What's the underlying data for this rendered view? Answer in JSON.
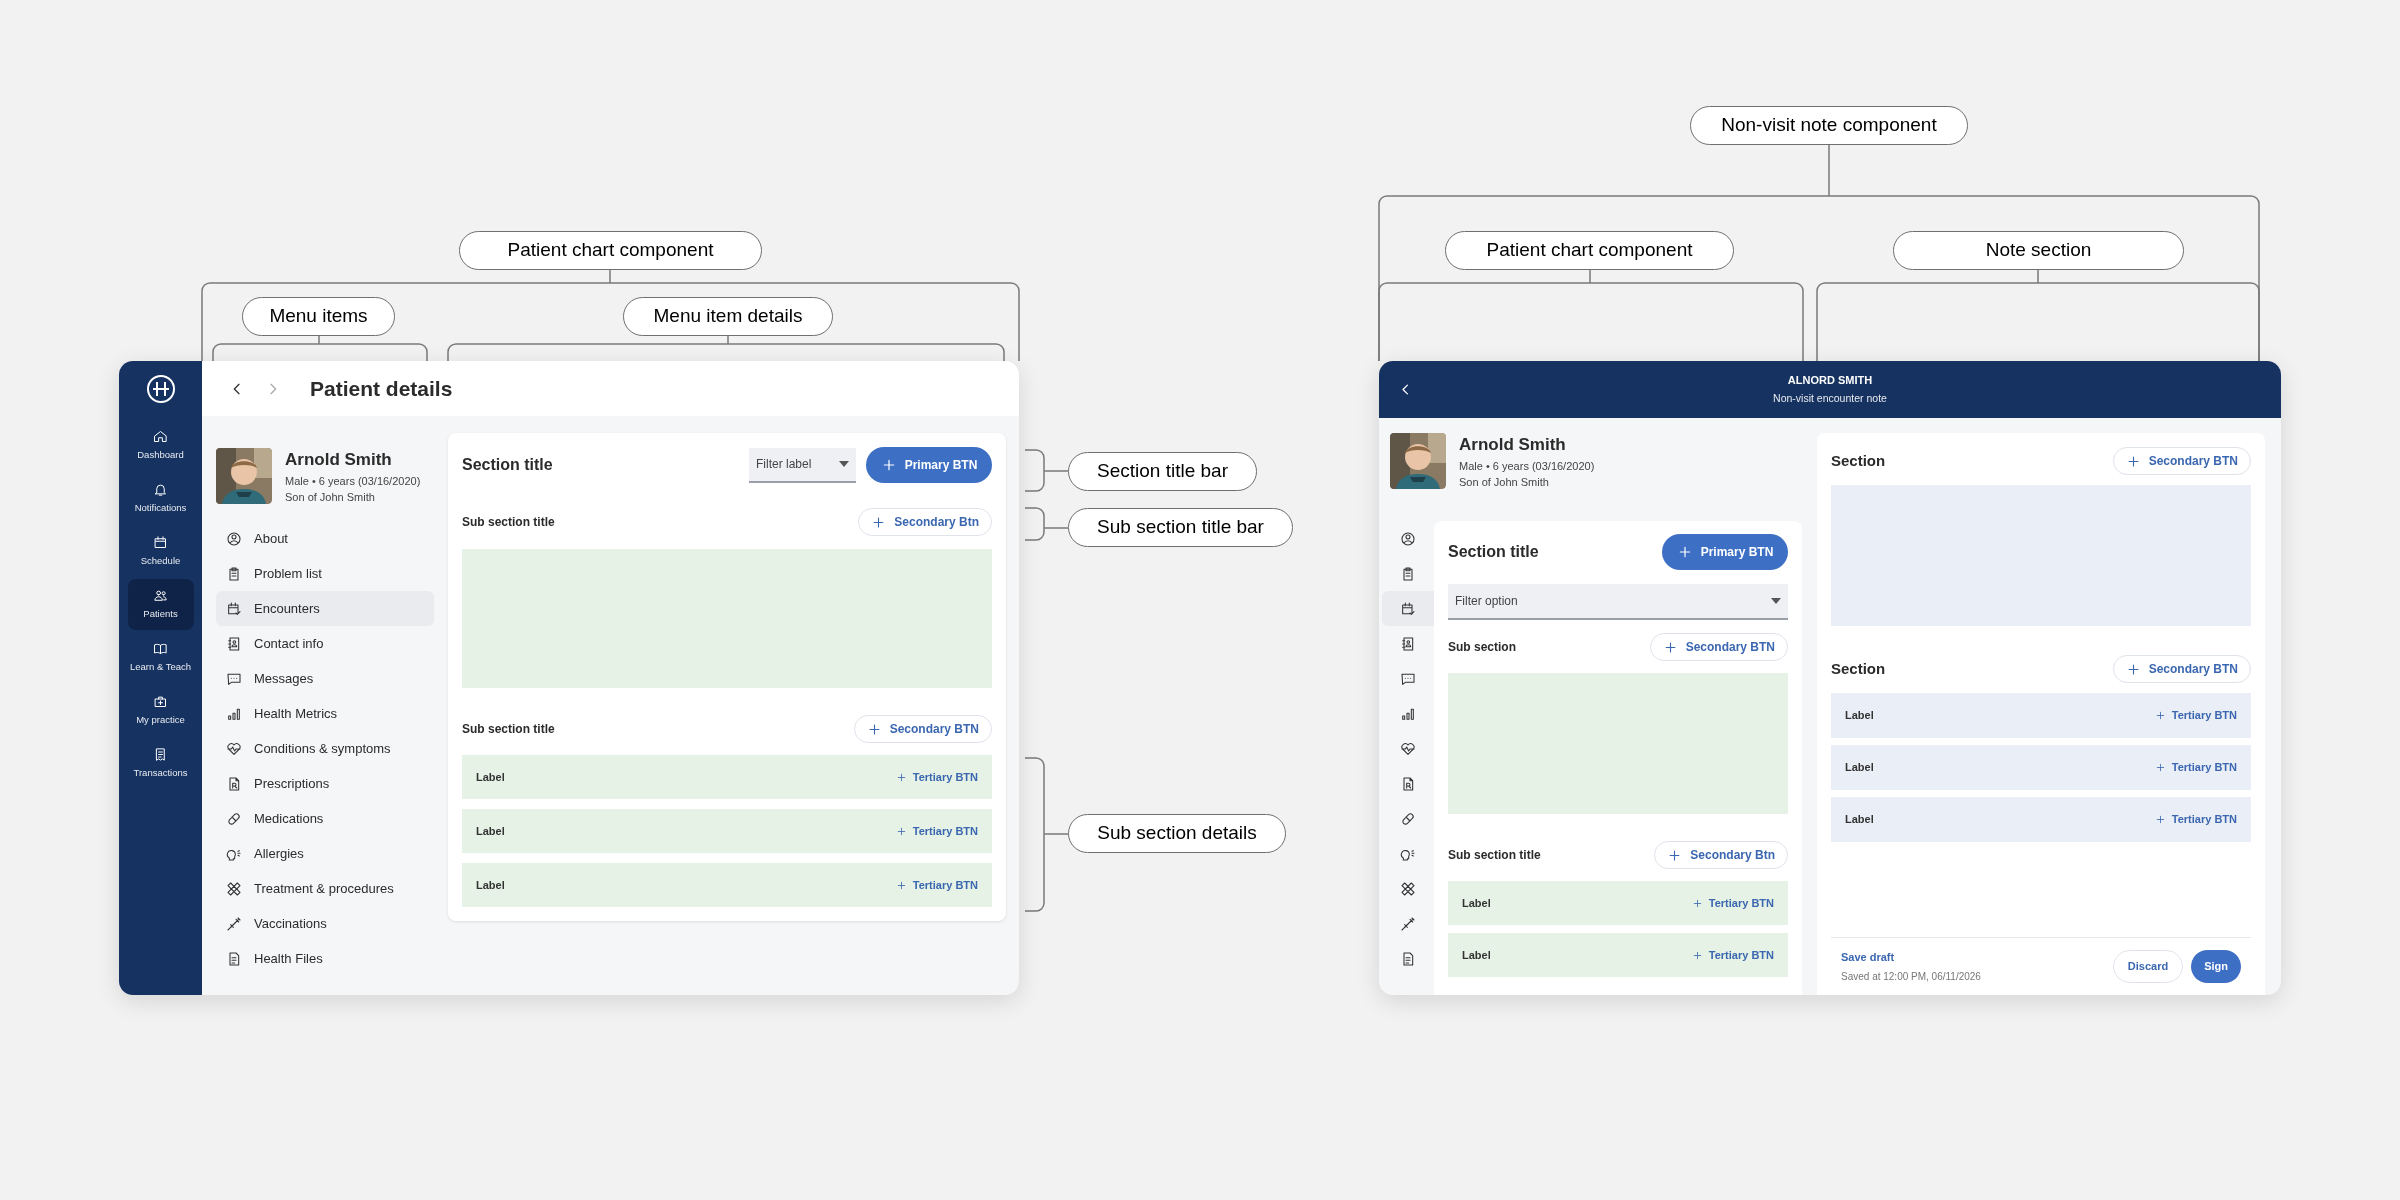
{
  "annotations": [
    "Patient chart component",
    "Menu items",
    "Menu item details",
    "Section title bar",
    "Sub section title bar",
    "Sub section details",
    "Non-visit note component",
    "Patient chart component",
    "Note section"
  ],
  "patient_chart": {
    "nav": [
      {
        "label": "Dashboard",
        "selected": false
      },
      {
        "label": "Notifications",
        "selected": false
      },
      {
        "label": "Schedule",
        "selected": false
      },
      {
        "label": "Patients",
        "selected": true
      },
      {
        "label": "Learn & Teach",
        "selected": false
      },
      {
        "label": "My practice",
        "selected": false
      },
      {
        "label": "Transactions",
        "selected": false
      }
    ],
    "title": "Patient details",
    "patient": {
      "name": "Arnold Smith",
      "details": "Male • 6 years (03/16/2020)",
      "relation": "Son of John Smith"
    },
    "menu": [
      {
        "label": "About",
        "selected": false
      },
      {
        "label": "Problem list",
        "selected": false
      },
      {
        "label": "Encounters",
        "selected": true
      },
      {
        "label": "Contact info",
        "selected": false
      },
      {
        "label": "Messages",
        "selected": false
      },
      {
        "label": "Health Metrics",
        "selected": false
      },
      {
        "label": "Conditions & symptoms",
        "selected": false
      },
      {
        "label": "Prescriptions",
        "selected": false
      },
      {
        "label": "Medications",
        "selected": false
      },
      {
        "label": "Allergies",
        "selected": false
      },
      {
        "label": "Treatment & procedures",
        "selected": false
      },
      {
        "label": "Vaccinations",
        "selected": false
      },
      {
        "label": "Health Files",
        "selected": false
      }
    ],
    "section": {
      "title": "Section title",
      "filter": "Filter label",
      "primary_button": "Primary BTN",
      "subsections": [
        {
          "kind": "block",
          "title": "Sub section title",
          "button": "Secondary Btn"
        },
        {
          "kind": "rows",
          "title": "Sub section title",
          "button": "Secondary BTN",
          "rows": [
            {
              "label": "Label",
              "button": "Tertiary BTN"
            },
            {
              "label": "Label",
              "button": "Tertiary BTN"
            },
            {
              "label": "Label",
              "button": "Tertiary BTN"
            }
          ]
        }
      ]
    }
  },
  "note": {
    "header": {
      "title": "ALNORD SMITH",
      "subtitle": "Non-visit encounter note"
    },
    "patient": {
      "name": "Arnold Smith",
      "details": "Male • 6 years (03/16/2020)",
      "relation": "Son of John Smith"
    },
    "icon_menu": [
      {
        "selected": false
      },
      {
        "selected": false
      },
      {
        "selected": true
      },
      {
        "selected": false
      },
      {
        "selected": false
      },
      {
        "selected": false
      },
      {
        "selected": false
      },
      {
        "selected": false
      },
      {
        "selected": false
      },
      {
        "selected": false
      },
      {
        "selected": false
      },
      {
        "selected": false
      },
      {
        "selected": false
      }
    ],
    "section": {
      "title": "Section title",
      "primary_button": "Primary BTN",
      "filter": "Filter option",
      "subsections": [
        {
          "kind": "block",
          "title": "Sub section",
          "button": "Secondary BTN"
        },
        {
          "kind": "rows",
          "title": "Sub section title",
          "button": "Secondary Btn",
          "rows": [
            {
              "label": "Label",
              "button": "Tertiary BTN"
            },
            {
              "label": "Label",
              "button": "Tertiary BTN"
            }
          ]
        }
      ]
    },
    "note_section": {
      "sections": [
        {
          "kind": "block",
          "title": "Section",
          "button": "Secondary BTN"
        },
        {
          "kind": "rows",
          "title": "Section",
          "button": "Secondary BTN",
          "rows": [
            {
              "label": "Label",
              "button": "Tertiary BTN"
            },
            {
              "label": "Label",
              "button": "Tertiary BTN"
            },
            {
              "label": "Label",
              "button": "Tertiary BTN"
            }
          ]
        }
      ],
      "footer": {
        "link": "Save draft",
        "saved": "Saved at 12:00 PM, 06/11/2026",
        "discard": "Discard",
        "sign": "Sign"
      }
    }
  }
}
